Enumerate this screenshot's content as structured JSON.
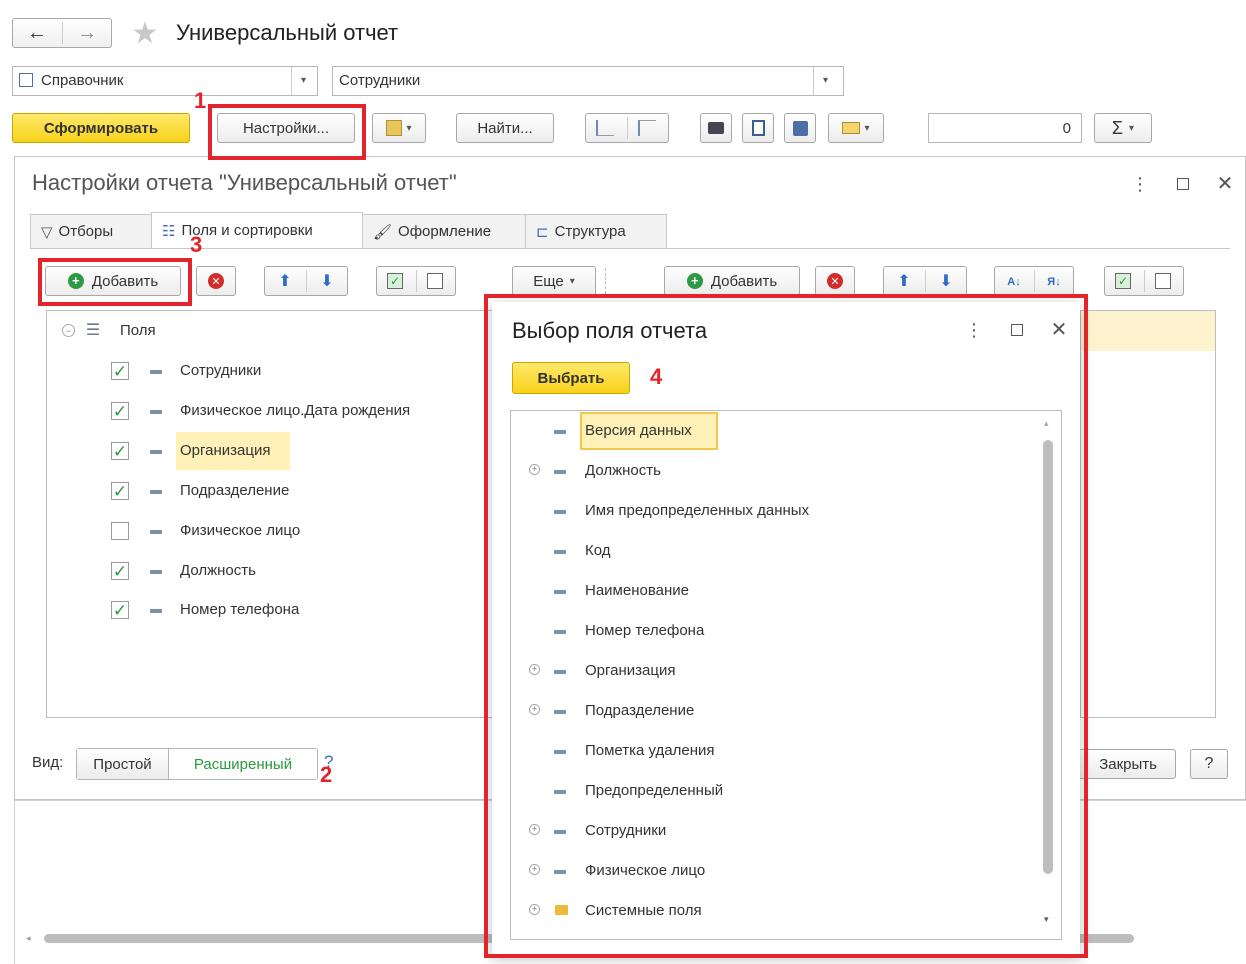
{
  "window": {
    "title": "Универсальный отчет"
  },
  "selectors": {
    "type_value": "Справочник",
    "object_value": "Сотрудники"
  },
  "toolbar": {
    "generate_label": "Сформировать",
    "settings_label": "Настройки...",
    "find_label": "Найти...",
    "sum_value": "0",
    "sigma": "Σ"
  },
  "settings": {
    "title": "Настройки отчета \"Универсальный отчет\"",
    "tabs": [
      "Отборы",
      "Поля и сортировки",
      "Оформление",
      "Структура"
    ],
    "add_label": "Добавить",
    "more_label": "Еще",
    "add2_label": "Добавить",
    "root_label": "Поля",
    "fields": [
      {
        "label": "Сотрудники",
        "checked": true
      },
      {
        "label": "Физическое лицо.Дата рождения",
        "checked": true
      },
      {
        "label": "Организация",
        "checked": true
      },
      {
        "label": "Подразделение",
        "checked": true
      },
      {
        "label": "Физическое лицо",
        "checked": false
      },
      {
        "label": "Должность",
        "checked": true
      },
      {
        "label": "Номер телефона",
        "checked": true
      }
    ],
    "view_label": "Вид:",
    "view_simple": "Простой",
    "view_extended": "Расширенный",
    "help_q": "?",
    "close_label": "Закрыть",
    "help_label": "?"
  },
  "picker": {
    "title": "Выбор поля отчета",
    "select_label": "Выбрать",
    "items": [
      {
        "label": "Версия данных",
        "expandable": false,
        "folder": false
      },
      {
        "label": "Должность",
        "expandable": true,
        "folder": false
      },
      {
        "label": "Имя предопределенных данных",
        "expandable": false,
        "folder": false
      },
      {
        "label": "Код",
        "expandable": false,
        "folder": false
      },
      {
        "label": "Наименование",
        "expandable": false,
        "folder": false
      },
      {
        "label": "Номер телефона",
        "expandable": false,
        "folder": false
      },
      {
        "label": "Организация",
        "expandable": true,
        "folder": false
      },
      {
        "label": "Подразделение",
        "expandable": true,
        "folder": false
      },
      {
        "label": "Пометка удаления",
        "expandable": false,
        "folder": false
      },
      {
        "label": "Предопределенный",
        "expandable": false,
        "folder": false
      },
      {
        "label": "Сотрудники",
        "expandable": true,
        "folder": false
      },
      {
        "label": "Физическое лицо",
        "expandable": true,
        "folder": false
      },
      {
        "label": "Системные поля",
        "expandable": true,
        "folder": true
      }
    ]
  },
  "annotations": [
    "1",
    "2",
    "3",
    "4"
  ],
  "colors": {
    "accent_red": "#e3242b",
    "highlight": "#fff1b8",
    "check_green": "#2a9a3a",
    "yellow_button": "#f7d21a"
  }
}
